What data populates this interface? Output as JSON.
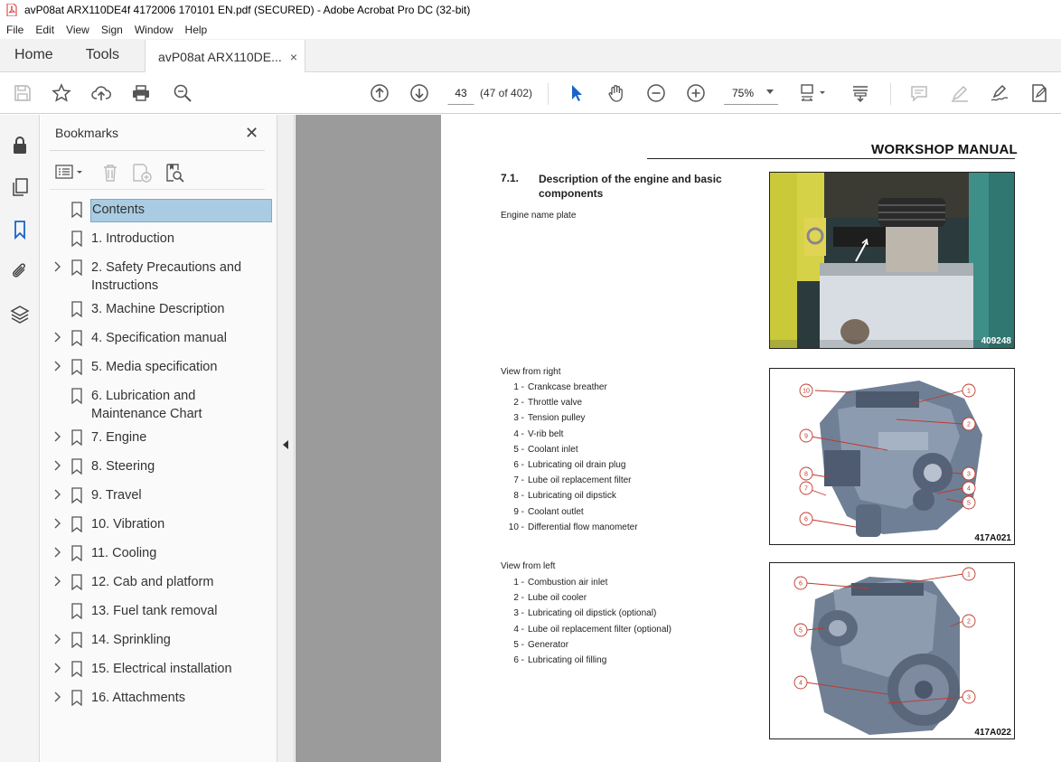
{
  "window": {
    "title": "avP08at ARX110DE4f 4172006 170101 EN.pdf (SECURED) - Adobe Acrobat Pro DC (32-bit)"
  },
  "menu": [
    "File",
    "Edit",
    "View",
    "Sign",
    "Window",
    "Help"
  ],
  "tabs": {
    "home": "Home",
    "tools": "Tools",
    "document": "avP08at ARX110DE...",
    "close": "×"
  },
  "toolbar": {
    "page_number": "43",
    "page_count": "(47 of 402)",
    "zoom": "75%"
  },
  "bookmarks": {
    "title": "Bookmarks",
    "close": "✕",
    "items": [
      {
        "label": "Contents",
        "expandable": false,
        "selected": true
      },
      {
        "label": "1. Introduction",
        "expandable": false
      },
      {
        "label": "2. Safety Precautions and Instructions",
        "expandable": true
      },
      {
        "label": "3. Machine Description",
        "expandable": false
      },
      {
        "label": "4. Specification manual",
        "expandable": true
      },
      {
        "label": "5. Media specification",
        "expandable": true
      },
      {
        "label": "6. Lubrication and Maintenance Chart",
        "expandable": false
      },
      {
        "label": "7. Engine",
        "expandable": true
      },
      {
        "label": "8. Steering",
        "expandable": true
      },
      {
        "label": "9. Travel",
        "expandable": true
      },
      {
        "label": "10. Vibration",
        "expandable": true
      },
      {
        "label": "11. Cooling",
        "expandable": true
      },
      {
        "label": "12. Cab and platform",
        "expandable": true
      },
      {
        "label": "13. Fuel tank removal",
        "expandable": false
      },
      {
        "label": "14. Sprinkling",
        "expandable": true
      },
      {
        "label": "15. Electrical installation",
        "expandable": true
      },
      {
        "label": "16. Attachments",
        "expandable": true
      }
    ]
  },
  "document": {
    "header": "WORKSHOP MANUAL",
    "section_number": "7.1.",
    "section_title": "Description of the engine and basic components",
    "nameplate_label": "Engine name plate",
    "figure1_caption": "409248",
    "view_right": {
      "title": "View from right",
      "items": [
        {
          "num": "1 -",
          "text": "Crankcase breather"
        },
        {
          "num": "2 -",
          "text": "Throttle valve"
        },
        {
          "num": "3 -",
          "text": "Tension pulley"
        },
        {
          "num": "4 -",
          "text": "V-rib belt"
        },
        {
          "num": "5 -",
          "text": "Coolant inlet"
        },
        {
          "num": "6 -",
          "text": "Lubricating oil drain plug"
        },
        {
          "num": "7 -",
          "text": "Lube oil replacement filter"
        },
        {
          "num": "8 -",
          "text": "Lubricating oil dipstick"
        },
        {
          "num": "9 -",
          "text": "Coolant outlet"
        },
        {
          "num": "10 -",
          "text": "Differential flow manometer"
        }
      ],
      "caption": "417A021"
    },
    "view_left": {
      "title": "View from left",
      "items": [
        {
          "num": "1 -",
          "text": "Combustion air inlet"
        },
        {
          "num": "2 -",
          "text": "Lube oil cooler"
        },
        {
          "num": "3 -",
          "text": "Lubricating oil dipstick (optional)"
        },
        {
          "num": "4 -",
          "text": "Lube oil replacement filter (optional)"
        },
        {
          "num": "5 -",
          "text": "Generator"
        },
        {
          "num": "6 -",
          "text": "Lubricating oil filling"
        }
      ],
      "caption": "417A022"
    }
  }
}
